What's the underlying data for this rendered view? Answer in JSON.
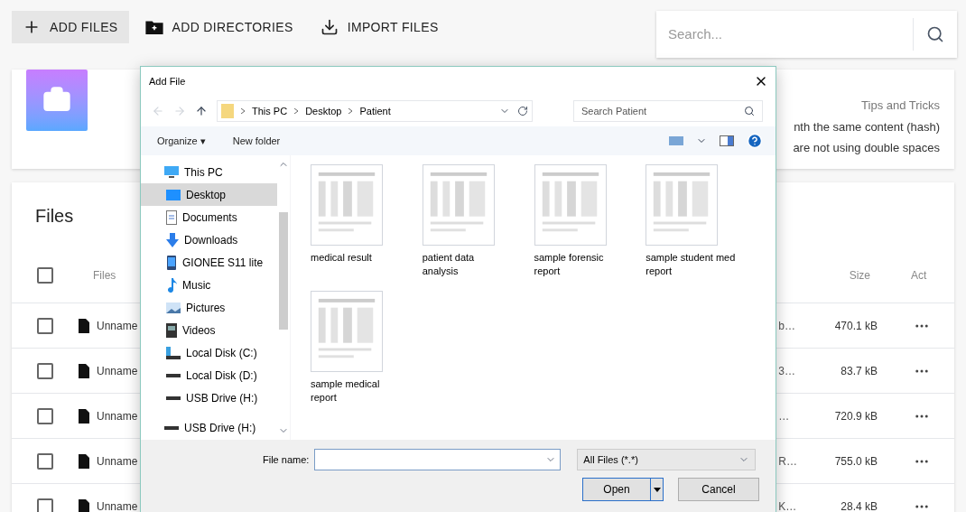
{
  "toolbar": [
    {
      "label": "ADD FILES",
      "kind": "add",
      "selected": true
    },
    {
      "label": "ADD DIRECTORIES",
      "kind": "folder",
      "selected": false
    },
    {
      "label": "IMPORT FILES",
      "kind": "import",
      "selected": false
    }
  ],
  "search": {
    "placeholder": "Search..."
  },
  "tips": {
    "title": "Tips and Tricks",
    "lines": [
      "nth the same content (hash)",
      "are not using double spaces"
    ]
  },
  "files": {
    "title": "Files",
    "all_checked": false,
    "columns": [
      "Files",
      "Size",
      "Act"
    ],
    "rows": [
      {
        "name": "Unname",
        "column_3": "b…",
        "size": "470.1 kB",
        "checked": false
      },
      {
        "name": "Unname",
        "column_3": "3…",
        "size": "83.7 kB",
        "checked": false
      },
      {
        "name": "Unname",
        "column_3": "…",
        "size": "720.9 kB",
        "checked": false
      },
      {
        "name": "Unname",
        "column_3": "R…",
        "size": "755.0 kB",
        "checked": false
      },
      {
        "name": "Unname",
        "column_3": "K…",
        "size": "28.4 kB",
        "checked": false
      }
    ]
  },
  "dialog": {
    "title": "Add File",
    "path": [
      "This PC",
      "Desktop",
      "Patient"
    ],
    "search_placeholder": "Search Patient",
    "commands": [
      "Organize ▾",
      "New folder"
    ],
    "nav": [
      {
        "label": "This PC",
        "kind": "pc",
        "selected": false,
        "children": [
          {
            "label": "Desktop",
            "kind": "desktop",
            "selected": true
          },
          {
            "label": "Documents",
            "kind": "docs",
            "selected": false
          },
          {
            "label": "Downloads",
            "kind": "download",
            "selected": false
          },
          {
            "label": "GIONEE S11 lite",
            "kind": "phone",
            "selected": false
          },
          {
            "label": "Music",
            "kind": "music",
            "selected": false
          },
          {
            "label": "Pictures",
            "kind": "pictures",
            "selected": false
          },
          {
            "label": "Videos",
            "kind": "videos",
            "selected": false
          },
          {
            "label": "Local Disk (C:)",
            "kind": "system",
            "selected": false
          },
          {
            "label": "Local Disk (D:)",
            "kind": "drive",
            "selected": false
          },
          {
            "label": "USB Drive (H:)",
            "kind": "drive",
            "selected": false
          }
        ]
      },
      {
        "label": "USB Drive (H:)",
        "kind": "drive",
        "selected": false
      }
    ],
    "items": [
      {
        "name": "medical result"
      },
      {
        "name": "patient data analysis"
      },
      {
        "name": "sample forensic report"
      },
      {
        "name": "sample student med report"
      },
      {
        "name": "sample medical report"
      }
    ],
    "file_name_label": "File name:",
    "file_type": "All Files (*.*)",
    "buttons": [
      {
        "label": "Open",
        "kind": "primary"
      },
      {
        "label": "Cancel",
        "kind": "secondary"
      }
    ]
  }
}
